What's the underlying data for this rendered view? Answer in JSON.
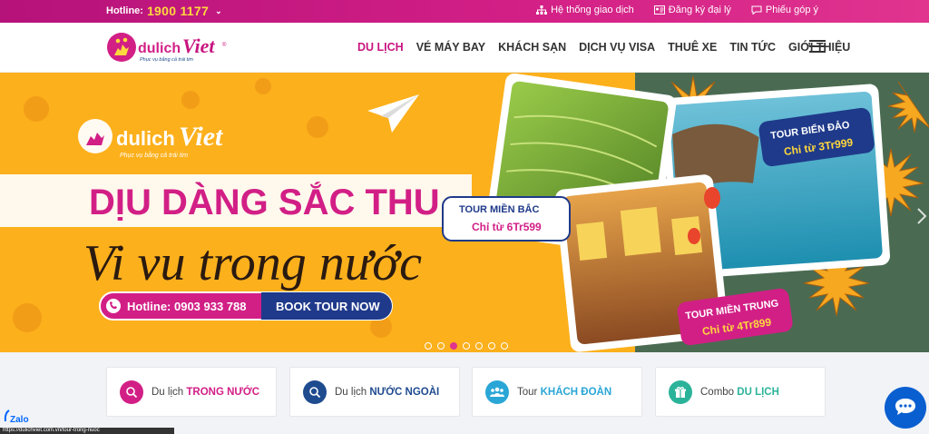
{
  "topbar": {
    "hotline_label": "Hotline:",
    "hotline_number": "1900 1177",
    "links": [
      {
        "label": "Hệ thống giao dịch",
        "icon": "network-icon"
      },
      {
        "label": "Đăng ký đại lý",
        "icon": "id-card-icon"
      },
      {
        "label": "Phiếu góp ý",
        "icon": "feedback-icon"
      }
    ]
  },
  "header": {
    "logo_text": "dulichViet",
    "logo_tagline": "Phục vụ bằng cả trái tim",
    "nav": [
      "DU LỊCH",
      "VÉ MÁY BAY",
      "KHÁCH SẠN",
      "DỊCH VỤ VISA",
      "THUÊ XE",
      "TIN TỨC",
      "GIỚI THIỆU"
    ],
    "active_index": 0
  },
  "banner": {
    "headline": "DỊU DÀNG SẮC THU",
    "script_line": "Vi vu trong nước",
    "hotline": "Hotline: 0903 933 788",
    "cta": "BOOK TOUR NOW",
    "tours": [
      {
        "name": "TOUR MIỀN BẮC",
        "price": "Chỉ từ 6Tr599"
      },
      {
        "name": "TOUR BIỂN ĐẢO",
        "price": "Chỉ từ 3Tr999"
      },
      {
        "name": "TOUR MIỀN TRUNG",
        "price": "Chỉ từ 4Tr899"
      }
    ],
    "slide_count": 7,
    "active_slide": 2
  },
  "cards": [
    {
      "prefix": "Du lịch",
      "highlight": "TRONG NƯỚC",
      "color": "#d21f86",
      "icon": "search-globe-icon"
    },
    {
      "prefix": "Du lịch",
      "highlight": "NƯỚC NGOÀI",
      "color": "#1f4b8f",
      "icon": "search-globe-icon"
    },
    {
      "prefix": "Tour",
      "highlight": "KHÁCH ĐOÀN",
      "color": "#2aa6d6",
      "icon": "group-icon"
    },
    {
      "prefix": "Combo",
      "highlight": "DU LỊCH",
      "color": "#2bb39a",
      "icon": "gift-icon"
    }
  ],
  "zalo_label": "Zalo",
  "status_url": "https://dulichviet.com.vn/tour-trong-nuoc"
}
